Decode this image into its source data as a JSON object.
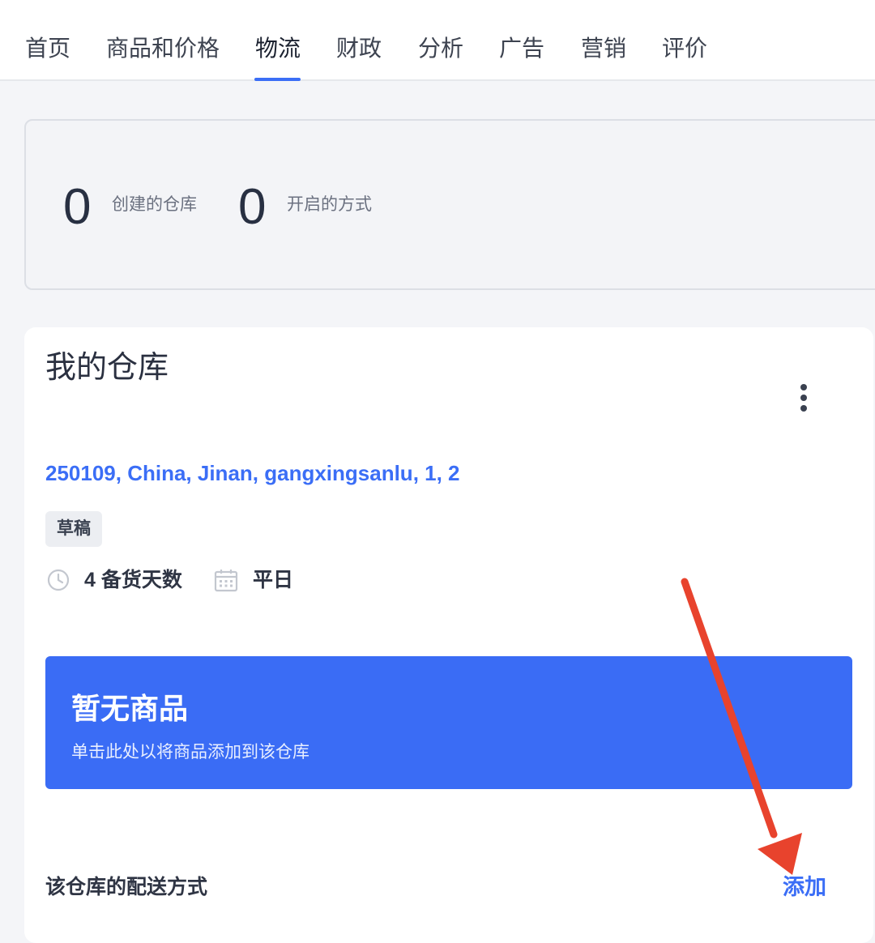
{
  "nav": {
    "tabs": [
      {
        "label": "首页"
      },
      {
        "label": "商品和价格"
      },
      {
        "label": "物流"
      },
      {
        "label": "财政"
      },
      {
        "label": "分析"
      },
      {
        "label": "广告"
      },
      {
        "label": "营销"
      },
      {
        "label": "评价"
      }
    ],
    "active_tab": "物流"
  },
  "stats": {
    "warehouses_count": "0",
    "warehouses_label": "创建的仓库",
    "methods_count": "0",
    "methods_label": "开启的方式"
  },
  "warehouse": {
    "title": "我的仓库",
    "address": "250109, China, Jinan, gangxingsanlu, 1, 2",
    "status_badge": "草稿",
    "prep_days": "4 备货天数",
    "schedule": "平日",
    "empty_title": "暂无商品",
    "empty_subtitle": "单击此处以将商品添加到该仓库",
    "shipping_label": "该仓库的配送方式",
    "add_label": "添加"
  },
  "colors": {
    "accent": "#3b6ef6",
    "banner": "#3a6cf5",
    "annotation_arrow": "#e8432d"
  },
  "icons": [
    "kebab-menu-icon",
    "clock-icon",
    "calendar-icon",
    "annotation-arrow"
  ]
}
